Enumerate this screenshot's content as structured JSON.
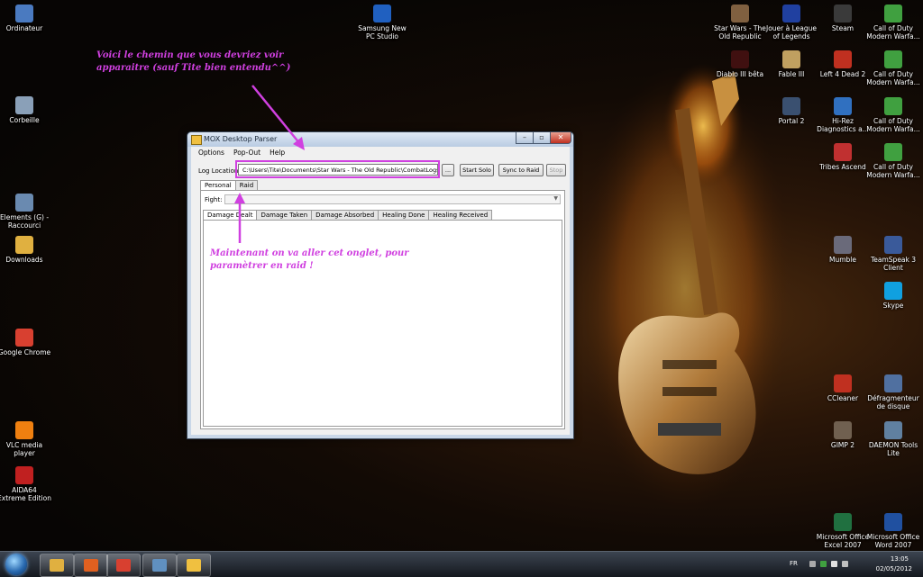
{
  "desktop": {
    "left_icons": [
      {
        "label": "Ordinateur",
        "icon": "computer-icon",
        "color": "#4a7ac0"
      },
      {
        "label": "Corbeille",
        "icon": "recycle-bin-icon",
        "color": "#8aa0b8"
      },
      {
        "label": "Elements (G) - Raccourci",
        "icon": "drive-shortcut-icon",
        "color": "#6a8ab0"
      },
      {
        "label": "Downloads",
        "icon": "downloads-folder-icon",
        "color": "#e0b040"
      },
      {
        "label": "Google Chrome",
        "icon": "chrome-icon",
        "color": "#d84030"
      },
      {
        "label": "VLC media player",
        "icon": "vlc-icon",
        "color": "#f08010"
      },
      {
        "label": "AIDA64 Extreme Edition",
        "icon": "aida64-icon",
        "color": "#c02020"
      }
    ],
    "top_icons": [
      {
        "label": "Samsung New PC Studio",
        "icon": "samsung-pc-studio-icon",
        "color": "#2060c0"
      }
    ],
    "right_icons_col1": [
      {
        "label": "Star Wars - The Old Republic",
        "icon": "swtor-icon",
        "color": "#806040"
      },
      {
        "label": "Diablo III bêta",
        "icon": "diablo-icon",
        "color": "#401010"
      }
    ],
    "right_icons_col2": [
      {
        "label": "Jouer à League of Legends",
        "icon": "league-icon",
        "color": "#2040a0"
      },
      {
        "label": "Fable III",
        "icon": "fable-icon",
        "color": "#c0a060"
      },
      {
        "label": "Portal 2",
        "icon": "portal-icon",
        "color": "#3a5070"
      }
    ],
    "right_icons_col3": [
      {
        "label": "Steam",
        "icon": "steam-icon",
        "color": "#3a3a3a"
      },
      {
        "label": "Left 4 Dead 2",
        "icon": "left4dead-icon",
        "color": "#c03020"
      },
      {
        "label": "Hi-Rez Diagnostics a...",
        "icon": "hirez-icon",
        "color": "#3070c0"
      },
      {
        "label": "Tribes Ascend",
        "icon": "tribes-icon",
        "color": "#c03030"
      },
      {
        "label": "Mumble",
        "icon": "mumble-icon",
        "color": "#6a6a7a"
      },
      {
        "label": "CCleaner",
        "icon": "ccleaner-icon",
        "color": "#c03020"
      },
      {
        "label": "GIMP 2",
        "icon": "gimp-icon",
        "color": "#706050"
      },
      {
        "label": "Microsoft Office Excel 2007",
        "icon": "excel-icon",
        "color": "#207040"
      }
    ],
    "right_icons_col4": [
      {
        "label": "Call of Duty Modern Warfa...",
        "icon": "cod-icon",
        "color": "#40a040"
      },
      {
        "label": "Call of Duty Modern Warfa...",
        "icon": "cod-icon",
        "color": "#40a040"
      },
      {
        "label": "Call of Duty Modern Warfa...",
        "icon": "cod-icon",
        "color": "#40a040"
      },
      {
        "label": "Call of Duty Modern Warfa...",
        "icon": "cod-icon",
        "color": "#40a040"
      },
      {
        "label": "TeamSpeak 3 Client",
        "icon": "teamspeak-icon",
        "color": "#3a5a9a"
      },
      {
        "label": "Skype",
        "icon": "skype-icon",
        "color": "#10a0e0"
      },
      {
        "label": "Défragmenteur de disque",
        "icon": "defrag-icon",
        "color": "#5070a0"
      },
      {
        "label": "DAEMON Tools Lite",
        "icon": "daemon-tools-icon",
        "color": "#6080a0"
      },
      {
        "label": "Microsoft Office Word 2007",
        "icon": "word-icon",
        "color": "#2050a0"
      }
    ]
  },
  "window": {
    "title": "MOX Desktop Parser",
    "controls": {
      "min": "–",
      "max": "▫",
      "close": "✕"
    },
    "menu": [
      "Options",
      "Pop-Out",
      "Help"
    ],
    "log_label": "Log Location:",
    "log_path": "C:\\Users\\Tite\\Documents\\Star Wars - The Old Republic\\CombatLogs",
    "browse_label": "...",
    "start_solo_label": "Start Solo",
    "sync_label": "Sync to Raid",
    "stop_label": "Stop",
    "outer_tabs": [
      "Personal",
      "Raid"
    ],
    "fight_label": "Fight:",
    "inner_tabs": [
      "Damage Dealt",
      "Damage Taken",
      "Damage Absorbed",
      "Healing Done",
      "Healing Received"
    ]
  },
  "annotations": {
    "top": "Voici le chemin que vous devriez voir apparaitre (sauf Tite bien entendu^^)",
    "middle": "Maintenant on va aller cet onglet, pour paramètrer en raid !",
    "color": "#d040e0"
  },
  "taskbar": {
    "pinned": [
      {
        "name": "explorer-icon",
        "color": "#e0b040"
      },
      {
        "name": "media-player-icon",
        "color": "#e06020"
      },
      {
        "name": "chrome-icon",
        "color": "#d84030"
      },
      {
        "name": "paint-icon",
        "color": "#6090c0"
      },
      {
        "name": "mox-parser-icon",
        "color": "#f0c040"
      }
    ],
    "language": "FR",
    "time": "13:05",
    "date": "02/05/2012"
  }
}
